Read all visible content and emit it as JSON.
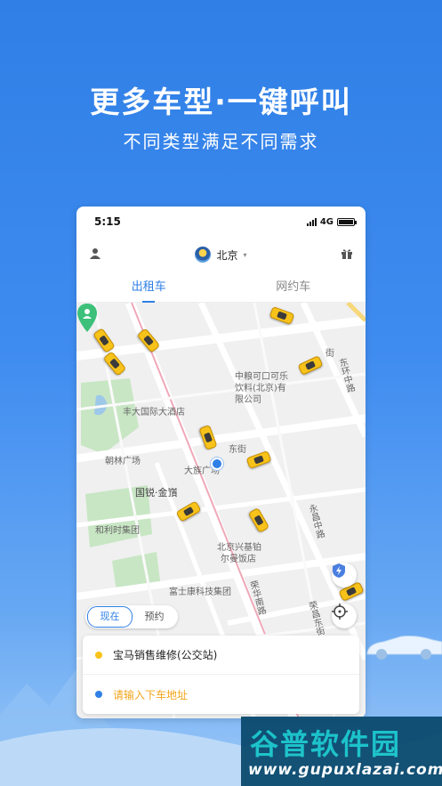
{
  "hero": {
    "title": "更多车型·一键呼叫",
    "subtitle": "不同类型满足不同需求"
  },
  "statusbar": {
    "time": "5:15",
    "network": "4G"
  },
  "topbar": {
    "city": "北京",
    "user_icon": "person-icon",
    "gift_icon": "gift-icon"
  },
  "tabs": [
    {
      "label": "出租车",
      "active": true
    },
    {
      "label": "网约车",
      "active": false
    }
  ],
  "map": {
    "labels": {
      "l1": "中粮可口可乐",
      "l2": "饮料(北京)有",
      "l3": "限公司",
      "l4": "丰大国际大酒店",
      "l5": "朝林广场",
      "l6": "大族广场",
      "l7": "东街",
      "l8": "国锐·金嵿",
      "l9": "和利时集团",
      "l10": "北京兴基铂",
      "l11": "尔曼饭店",
      "l12": "富士康科技集团",
      "l13": "荣华南路",
      "l14": "永昌中路",
      "l15": "荣昌东街",
      "l16": "东环中路",
      "l17": "街"
    }
  },
  "time_toggle": {
    "now": "现在",
    "reserve": "预约"
  },
  "address": {
    "pickup": "宝马销售维修(公交站)",
    "dropoff_placeholder": "请输入下车地址",
    "pickup_color": "#f7c21a",
    "dropoff_color": "#2f7fe6"
  },
  "watermark": {
    "title": "谷普软件园",
    "url": "www.gupuxlazai.com"
  },
  "colors": {
    "brand": "#2f7fe6",
    "taxi": "#f7c21a"
  }
}
